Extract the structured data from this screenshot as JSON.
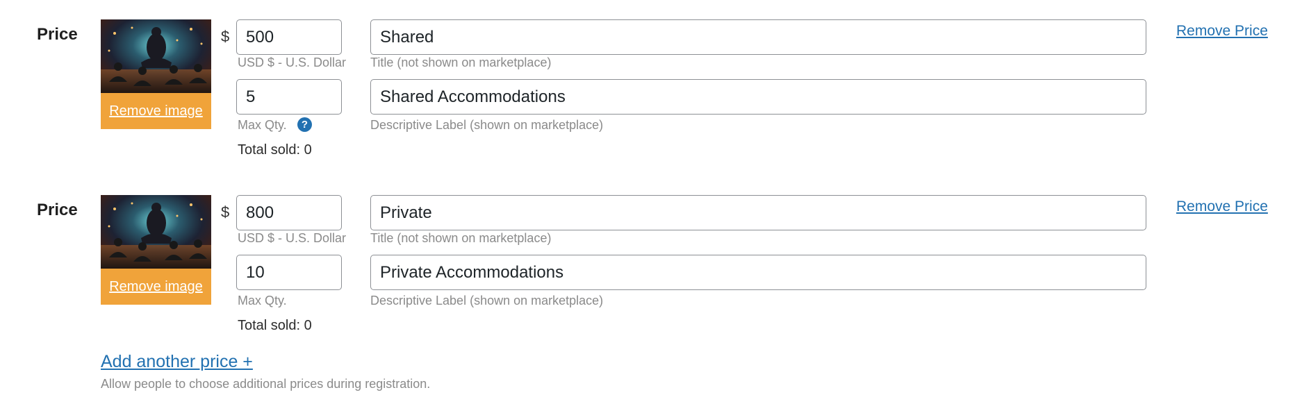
{
  "prices": [
    {
      "row_label": "Price",
      "remove_image_label": "Remove image",
      "currency_symbol": "$",
      "amount": "500",
      "currency_hint": "USD $ - U.S. Dollar",
      "max_qty": "5",
      "max_qty_hint": "Max Qty.",
      "show_help_icon": true,
      "help_icon": "question-circle-icon",
      "total_sold": "Total sold: 0",
      "title": "Shared",
      "title_hint": "Title (not shown on marketplace)",
      "descriptive_label": "Shared Accommodations",
      "descriptive_label_hint": "Descriptive Label (shown on marketplace)",
      "remove_price_label": "Remove Price"
    },
    {
      "row_label": "Price",
      "remove_image_label": "Remove image",
      "currency_symbol": "$",
      "amount": "800",
      "currency_hint": "USD $ - U.S. Dollar",
      "max_qty": "10",
      "max_qty_hint": "Max Qty.",
      "show_help_icon": false,
      "total_sold": "Total sold: 0",
      "title": "Private",
      "title_hint": "Title (not shown on marketplace)",
      "descriptive_label": "Private Accommodations",
      "descriptive_label_hint": "Descriptive Label (shown on marketplace)",
      "remove_price_label": "Remove Price"
    }
  ],
  "add_price": {
    "label": "Add another price +",
    "hint": "Allow people to choose additional prices during registration."
  },
  "colors": {
    "link": "#2271b1",
    "remove_image_bg": "#f0a33a",
    "hint_text": "#8a8a8a"
  }
}
